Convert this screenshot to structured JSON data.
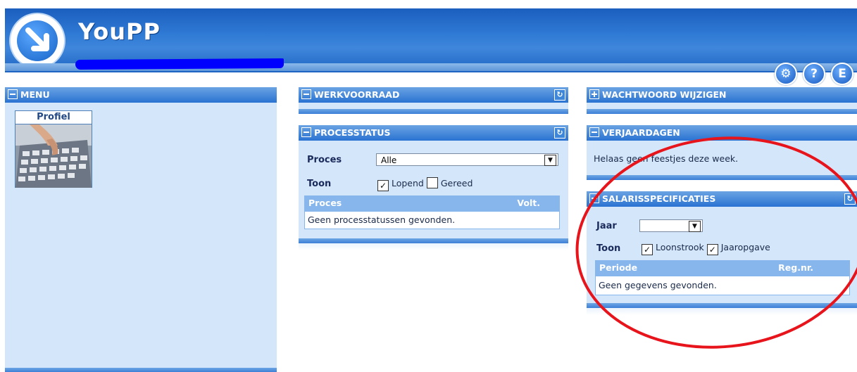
{
  "app": {
    "title": "YouPP",
    "header_buttons": [
      {
        "icon": "users-settings-icon",
        "glyph": "✪"
      },
      {
        "icon": "help-icon",
        "glyph": "?"
      },
      {
        "icon": "logout-icon",
        "glyph": "E"
      }
    ]
  },
  "menu": {
    "title": "MENU",
    "items": [
      {
        "label": "Profiel"
      }
    ]
  },
  "werkvoorraad": {
    "title": "WERKVOORRAAD"
  },
  "processtatus": {
    "title": "PROCESSTATUS",
    "proces_label": "Proces",
    "proces_value": "Alle",
    "toon_label": "Toon",
    "check_lopend": "Lopend",
    "check_lopend_checked": true,
    "check_gereed": "Gereed",
    "check_gereed_checked": false,
    "col_proces": "Proces",
    "col_volt": "Volt.",
    "empty_text": "Geen processtatussen gevonden."
  },
  "wachtwoord": {
    "title": "WACHTWOORD WIJZIGEN"
  },
  "verjaardagen": {
    "title": "VERJAARDAGEN",
    "text": "Helaas geen feestjes deze week."
  },
  "salaris": {
    "title": "SALARISSPECIFICATIES",
    "jaar_label": "Jaar",
    "jaar_value": "",
    "toon_label": "Toon",
    "check_loonstrook": "Loonstrook",
    "check_loonstrook_checked": true,
    "check_jaaropgave": "Jaaropgave",
    "check_jaaropgave_checked": true,
    "col_periode": "Periode",
    "col_regnr": "Reg.nr.",
    "empty_text": "Geen gegevens gevonden."
  },
  "annotation": {
    "color": "#e8141c"
  }
}
